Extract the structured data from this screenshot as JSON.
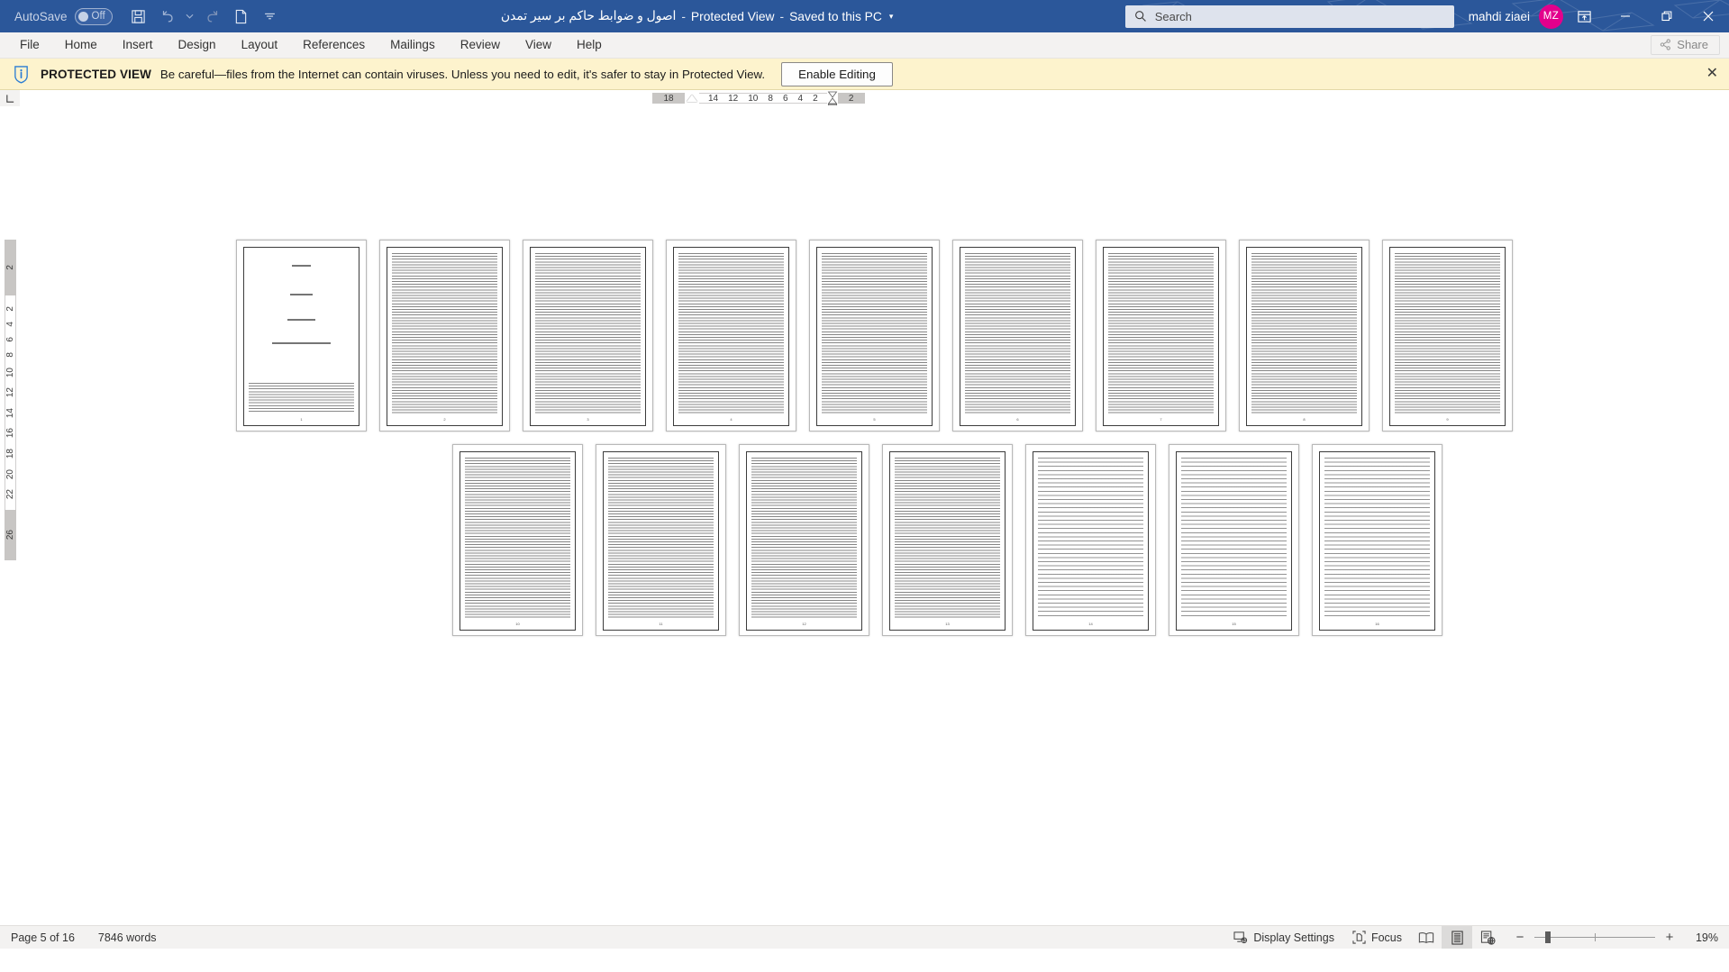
{
  "titlebar": {
    "autosave_label": "AutoSave",
    "autosave_state": "Off",
    "quick_access": [
      "save-icon",
      "undo-icon",
      "undo-dropdown-icon",
      "redo-icon",
      "new-doc-icon",
      "customize-qat-icon"
    ],
    "doc_title": "اصول و ضوابط حاکم بر سیر تمدن",
    "sep1": "-",
    "mode": "Protected View",
    "sep2": "-",
    "saved_state": "Saved to this PC",
    "title_dropdown": "▾",
    "search_placeholder": "Search",
    "user_name": "mahdi ziaei",
    "user_initials": "MZ",
    "avatar_color": "#e3008c",
    "ribbon_display_options": "ribbon-display-options-icon",
    "minimize": "—",
    "restore": "restore-icon",
    "close": "✕"
  },
  "ribbon": {
    "tabs": [
      {
        "label": "File"
      },
      {
        "label": "Home"
      },
      {
        "label": "Insert"
      },
      {
        "label": "Design"
      },
      {
        "label": "Layout"
      },
      {
        "label": "References"
      },
      {
        "label": "Mailings"
      },
      {
        "label": "Review"
      },
      {
        "label": "View"
      },
      {
        "label": "Help"
      }
    ],
    "share_label": "Share"
  },
  "protected_view": {
    "icon": "info-shield-icon",
    "strong": "PROTECTED VIEW",
    "message": "Be careful—files from the Internet can contain viruses. Unless you need to edit, it's safer to stay in Protected View.",
    "button_label": "Enable Editing",
    "close_label": "✕",
    "bg_color": "#fdf3cd"
  },
  "rulers": {
    "horizontal_left_margin": "18",
    "horizontal_ticks": [
      "14",
      "12",
      "10",
      "8",
      "6",
      "4",
      "2"
    ],
    "horizontal_right_margin": "2",
    "vertical_top_margin": "2",
    "vertical_ticks": [
      "2",
      "4",
      "6",
      "8",
      "10",
      "12",
      "14",
      "16",
      "18",
      "20",
      "22"
    ],
    "vertical_bottom_margin": "26"
  },
  "document": {
    "pages_row1": [
      {
        "kind": "title",
        "folio": "1"
      },
      {
        "kind": "text",
        "folio": "2"
      },
      {
        "kind": "text",
        "folio": "3"
      },
      {
        "kind": "text",
        "folio": "4"
      },
      {
        "kind": "text",
        "folio": "5"
      },
      {
        "kind": "text",
        "folio": "6"
      },
      {
        "kind": "text",
        "folio": "7"
      },
      {
        "kind": "text",
        "folio": "8"
      },
      {
        "kind": "text",
        "folio": "9"
      }
    ],
    "pages_row2": [
      {
        "kind": "text",
        "folio": "10"
      },
      {
        "kind": "text",
        "folio": "11"
      },
      {
        "kind": "text",
        "folio": "12"
      },
      {
        "kind": "text",
        "folio": "13"
      },
      {
        "kind": "sparse",
        "folio": "14"
      },
      {
        "kind": "sparse",
        "folio": "15"
      },
      {
        "kind": "sparse",
        "folio": "16"
      }
    ]
  },
  "statusbar": {
    "page_indicator": "Page 5 of 16",
    "word_count": "7846 words",
    "display_settings": "Display Settings",
    "focus": "Focus",
    "read_mode_icon": "read-mode-icon",
    "print_layout_icon": "print-layout-icon",
    "web_layout_icon": "web-layout-icon",
    "zoom_out": "−",
    "zoom_in": "+",
    "zoom_level": "19%"
  }
}
